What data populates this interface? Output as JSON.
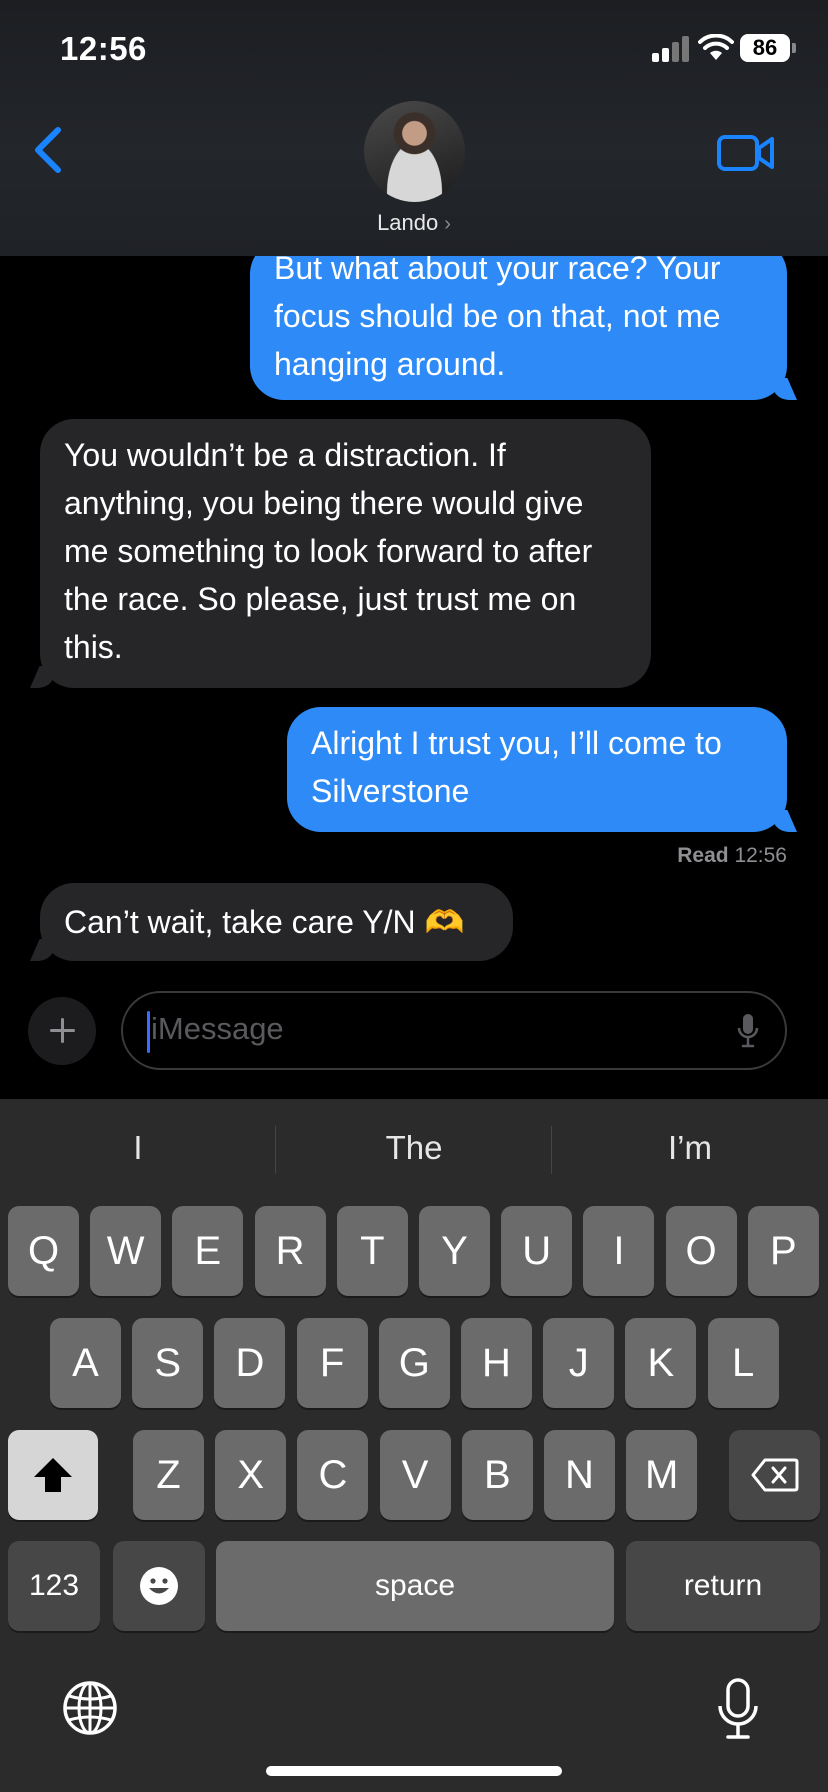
{
  "status_bar": {
    "time": "12:56",
    "battery": "86"
  },
  "header": {
    "contact_name": "Lando",
    "chevron": "›"
  },
  "messages": [
    {
      "from": "me",
      "text": "But what about your race? Your focus should be on that, not me hanging around."
    },
    {
      "from": "them",
      "text": "You wouldn’t be a distraction. If anything, you being there would give me something to look forward to after the race. So please, just trust me on this."
    },
    {
      "from": "me",
      "text": "Alright I trust you, I’ll come to Silverstone"
    },
    {
      "from": "them",
      "text": "Can’t wait, take care Y/N 🫶"
    }
  ],
  "read_receipt": {
    "label": "Read",
    "time": "12:56"
  },
  "input": {
    "placeholder": "iMessage"
  },
  "keyboard": {
    "suggestions": [
      "I",
      "The",
      "I’m"
    ],
    "row1": [
      "Q",
      "W",
      "E",
      "R",
      "T",
      "Y",
      "U",
      "I",
      "O",
      "P"
    ],
    "row2": [
      "A",
      "S",
      "D",
      "F",
      "G",
      "H",
      "J",
      "K",
      "L"
    ],
    "row3": [
      "Z",
      "X",
      "C",
      "V",
      "B",
      "N",
      "M"
    ],
    "numbers_label": "123",
    "space_label": "space",
    "return_label": "return"
  },
  "colors": {
    "sent_bubble": "#2d8af6",
    "received_bubble": "#262628",
    "accent": "#1a84ff"
  }
}
